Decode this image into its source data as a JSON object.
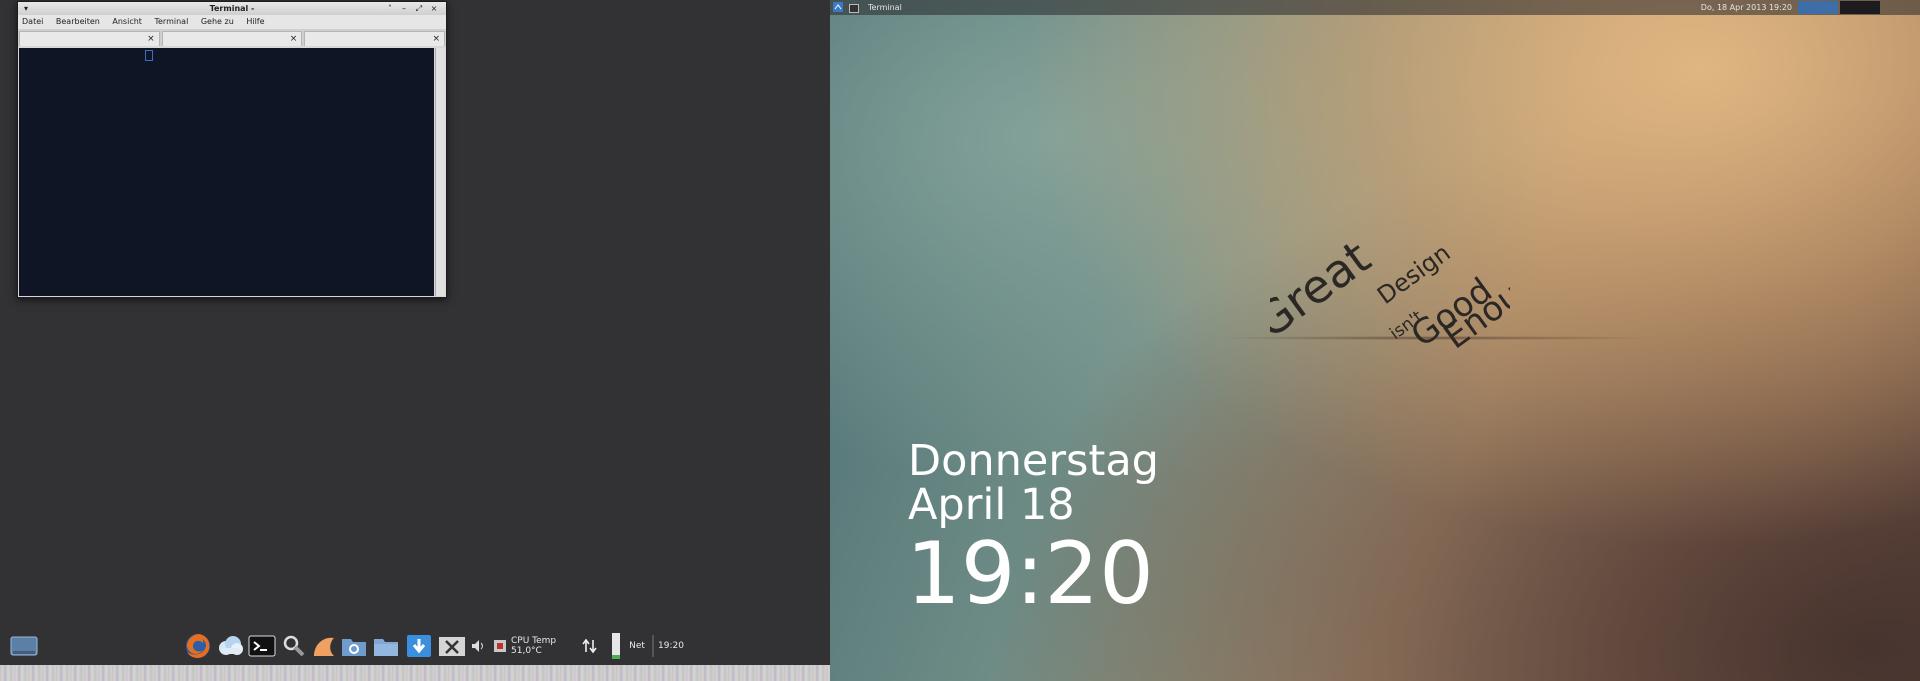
{
  "terminal": {
    "title": "Terminal -",
    "menu": [
      "Datei",
      "Bearbeiten",
      "Ansicht",
      "Terminal",
      "Gehe zu",
      "Hilfe"
    ],
    "tab_close": "×",
    "controls": {
      "menu": "▾",
      "shade": "˄",
      "minimize": "–",
      "maximize": "⤢",
      "close": "×"
    }
  },
  "dock": {
    "cpu_temp": "CPU Temp 51,0°C",
    "net": "Net",
    "clock": "19:20",
    "volume_icon": "volume-icon"
  },
  "topbar": {
    "task_label": "Terminal",
    "datetime": "Do, 18 Apr 2013 19:20"
  },
  "wallpaper": {
    "line1": "Great",
    "line2": "Design",
    "line3": "isn't",
    "line4": "Good",
    "line5": "Enough"
  },
  "clock_widget": {
    "day": "Donnerstag",
    "date": "April 18",
    "time": "19:20"
  }
}
